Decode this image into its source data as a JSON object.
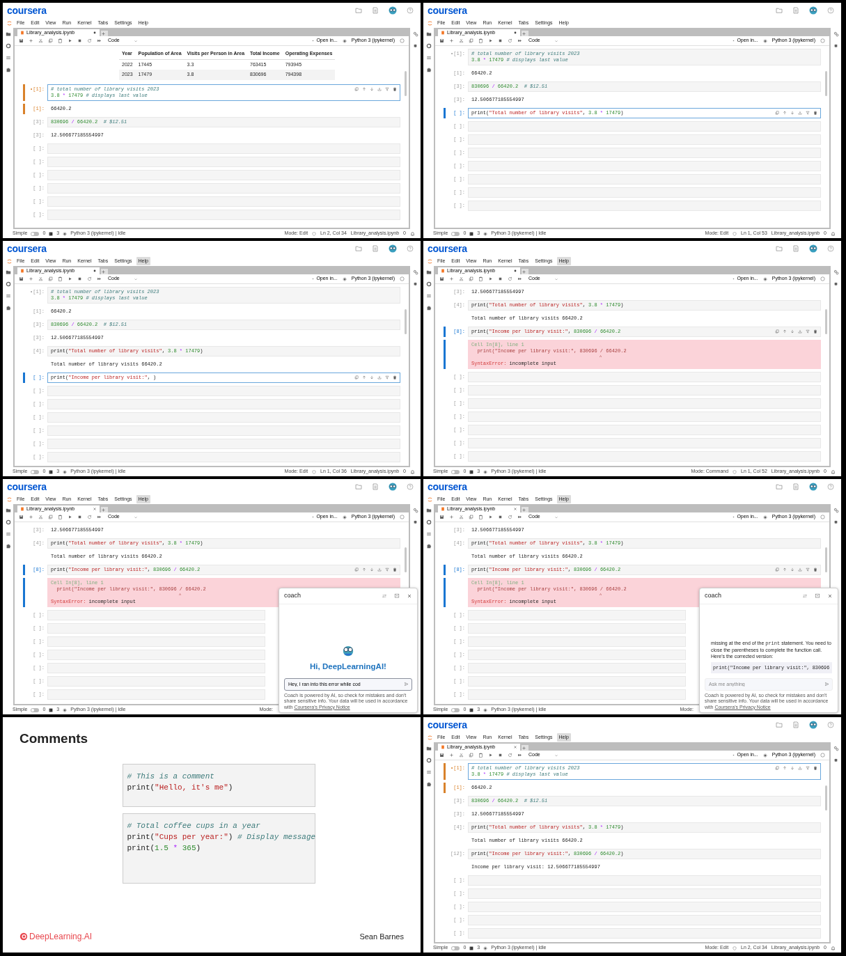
{
  "panels": [
    {
      "kind": "notebook",
      "logo": "coursera",
      "menu": [
        {
          "label": "File",
          "selected": false
        },
        {
          "label": "Edit",
          "selected": false
        },
        {
          "label": "View",
          "selected": false
        },
        {
          "label": "Run",
          "selected": false
        },
        {
          "label": "Kernel",
          "selected": false
        },
        {
          "label": "Tabs",
          "selected": false
        },
        {
          "label": "Settings",
          "selected": false
        },
        {
          "label": "Help",
          "selected": false
        }
      ],
      "tab": {
        "title": "Library_analysis.ipynb",
        "modified": true
      },
      "toolbar": {
        "cell_type": "Code",
        "open_in": "Open in...",
        "kernel": "Python 3 (ipykernel)"
      },
      "cells": [
        {
          "kind": "table",
          "columns": [
            "Year",
            "Population of Area",
            "Visits per Person in Area",
            "Total Income",
            "Operating Expenses"
          ],
          "rows": [
            [
              "2022",
              "17445",
              "3.3",
              "763415",
              "793945"
            ],
            [
              "2023",
              "17479",
              "3.8",
              "830696",
              "794398"
            ]
          ]
        },
        {
          "kind": "code",
          "prompt": "•[1]:",
          "lines": [
            "# total number of library visits 2023",
            "3.8 * 17479 # displays last value"
          ],
          "color": "#d9822b",
          "editing": true,
          "toolbar": true
        },
        {
          "kind": "output",
          "prompt": "[1]:",
          "lines": [
            "66420.2"
          ],
          "color": "#d9822b"
        },
        {
          "kind": "code",
          "prompt": "[3]:",
          "lines": [
            "830696 / 66420.2  # $12.51"
          ]
        },
        {
          "kind": "output",
          "prompt": "[3]:",
          "lines": [
            "12.506677185554997"
          ]
        },
        {
          "kind": "empty",
          "prompt": "[ ]:"
        },
        {
          "kind": "empty",
          "prompt": "[ ]:"
        },
        {
          "kind": "empty",
          "prompt": "[ ]:"
        },
        {
          "kind": "empty",
          "prompt": "[ ]:"
        },
        {
          "kind": "empty",
          "prompt": "[ ]:"
        },
        {
          "kind": "empty",
          "prompt": "[ ]:"
        }
      ],
      "status": {
        "label": "Simple",
        "simple": false,
        "terminals": "0",
        "kernels": "3",
        "kernel": "Python 3 (ipykernel) | Idle",
        "mode": "Mode: Edit",
        "position": "Ln 2, Col 34",
        "file": "Library_analysis.ipynb",
        "notifications": "0"
      }
    },
    {
      "kind": "notebook",
      "logo": "coursera",
      "menu": [
        {
          "label": "File",
          "selected": false
        },
        {
          "label": "Edit",
          "selected": false
        },
        {
          "label": "View",
          "selected": false
        },
        {
          "label": "Run",
          "selected": false
        },
        {
          "label": "Kernel",
          "selected": false
        },
        {
          "label": "Tabs",
          "selected": false
        },
        {
          "label": "Settings",
          "selected": false
        },
        {
          "label": "Help",
          "selected": false
        }
      ],
      "tab": {
        "title": "Library_analysis.ipynb",
        "modified": true
      },
      "toolbar": {
        "cell_type": "Code",
        "open_in": "Open in...",
        "kernel": "Python 3 (ipykernel)"
      },
      "cells": [
        {
          "kind": "code",
          "prompt": "•[1]:",
          "lines": [
            "# total number of library visits 2023",
            "3.8 * 17479 # displays last value"
          ]
        },
        {
          "kind": "output",
          "prompt": "[1]:",
          "lines": [
            "66420.2"
          ]
        },
        {
          "kind": "code",
          "prompt": "[3]:",
          "lines": [
            "830696 / 66420.2  # $12.51"
          ]
        },
        {
          "kind": "output",
          "prompt": "[3]:",
          "lines": [
            "12.506677185554997"
          ]
        },
        {
          "kind": "code",
          "prompt": "[ ]:",
          "lines": [
            "print(\"Total number of library visits\", 3.8 * 17479)"
          ],
          "color": "#1976d2",
          "editing": true,
          "toolbar": true
        },
        {
          "kind": "empty",
          "prompt": "[ ]:"
        },
        {
          "kind": "empty",
          "prompt": "[ ]:"
        },
        {
          "kind": "empty",
          "prompt": "[ ]:"
        },
        {
          "kind": "empty",
          "prompt": "[ ]:"
        },
        {
          "kind": "empty",
          "prompt": "[ ]:"
        },
        {
          "kind": "empty",
          "prompt": "[ ]:"
        },
        {
          "kind": "empty",
          "prompt": "[ ]:"
        }
      ],
      "status": {
        "label": "Simple",
        "simple": false,
        "terminals": "0",
        "kernels": "3",
        "kernel": "Python 3 (ipykernel) | Idle",
        "mode": "Mode: Edit",
        "position": "Ln 1, Col 53",
        "file": "Library_analysis.ipynb",
        "notifications": "0"
      }
    },
    {
      "kind": "notebook",
      "logo": "coursera",
      "menu": [
        {
          "label": "File",
          "selected": false
        },
        {
          "label": "Edit",
          "selected": false
        },
        {
          "label": "View",
          "selected": false
        },
        {
          "label": "Run",
          "selected": false
        },
        {
          "label": "Kernel",
          "selected": false
        },
        {
          "label": "Tabs",
          "selected": false
        },
        {
          "label": "Settings",
          "selected": false
        },
        {
          "label": "Help",
          "selected": true
        }
      ],
      "tab": {
        "title": "Library_analysis.ipynb",
        "modified": true
      },
      "toolbar": {
        "cell_type": "Code",
        "open_in": "Open in...",
        "kernel": "Python 3 (ipykernel)"
      },
      "cells": [
        {
          "kind": "code",
          "prompt": "•[1]:",
          "lines": [
            "# total number of library visits 2023",
            "3.8 * 17479 # displays last value"
          ]
        },
        {
          "kind": "output",
          "prompt": "[1]:",
          "lines": [
            "66420.2"
          ]
        },
        {
          "kind": "code",
          "prompt": "[3]:",
          "lines": [
            "830696 / 66420.2  # $12.51"
          ]
        },
        {
          "kind": "output",
          "prompt": "[3]:",
          "lines": [
            "12.506677185554997"
          ]
        },
        {
          "kind": "code",
          "prompt": "[4]:",
          "lines": [
            "print(\"Total number of library visits\", 3.8 * 17479)"
          ]
        },
        {
          "kind": "output",
          "lines": [
            "Total number of library visits 66420.2"
          ]
        },
        {
          "kind": "code",
          "prompt": "[ ]:",
          "lines": [
            "print(\"Income per library visit:\", )"
          ],
          "color": "#1976d2",
          "editing": true,
          "toolbar": true
        },
        {
          "kind": "empty",
          "prompt": "[ ]:"
        },
        {
          "kind": "empty",
          "prompt": "[ ]:"
        },
        {
          "kind": "empty",
          "prompt": "[ ]:"
        },
        {
          "kind": "empty",
          "prompt": "[ ]:"
        },
        {
          "kind": "empty",
          "prompt": "[ ]:"
        },
        {
          "kind": "empty",
          "prompt": "[ ]:"
        }
      ],
      "status": {
        "label": "Simple",
        "simple": false,
        "terminals": "0",
        "kernels": "3",
        "kernel": "Python 3 (ipykernel) | Idle",
        "mode": "Mode: Edit",
        "position": "Ln 1, Col 36",
        "file": "Library_analysis.ipynb",
        "notifications": "0"
      }
    },
    {
      "kind": "notebook",
      "logo": "coursera",
      "menu": [
        {
          "label": "File",
          "selected": false
        },
        {
          "label": "Edit",
          "selected": false
        },
        {
          "label": "View",
          "selected": false
        },
        {
          "label": "Run",
          "selected": false
        },
        {
          "label": "Kernel",
          "selected": false
        },
        {
          "label": "Tabs",
          "selected": false
        },
        {
          "label": "Settings",
          "selected": false
        },
        {
          "label": "Help",
          "selected": true
        }
      ],
      "tab": {
        "title": "Library_analysis.ipynb",
        "modified": true
      },
      "toolbar": {
        "cell_type": "Code",
        "open_in": "Open in...",
        "kernel": "Python 3 (ipykernel)"
      },
      "cells": [
        {
          "kind": "output",
          "prompt": "[3]:",
          "lines": [
            "12.506677185554997"
          ]
        },
        {
          "kind": "code",
          "prompt": "[4]:",
          "lines": [
            "print(\"Total number of library visits\", 3.8 * 17479)"
          ]
        },
        {
          "kind": "output",
          "lines": [
            "Total number of library visits 66420.2"
          ]
        },
        {
          "kind": "code",
          "prompt": "[8]:",
          "lines": [
            "print(\"Income per library visit:\", 830696 / 66420.2"
          ],
          "color": "#1976d2",
          "toolbar": true
        },
        {
          "kind": "error",
          "color": "#1976d2",
          "location": "Cell In[8], line 1",
          "source": "  print(\"Income per library visit:\", 830696 / 66420.2",
          "caret": "                                                   ^",
          "name": "SyntaxError:",
          "message": "incomplete input"
        },
        {
          "kind": "empty",
          "prompt": "[ ]:"
        },
        {
          "kind": "empty",
          "prompt": "[ ]:"
        },
        {
          "kind": "empty",
          "prompt": "[ ]:"
        },
        {
          "kind": "empty",
          "prompt": "[ ]:"
        },
        {
          "kind": "empty",
          "prompt": "[ ]:"
        },
        {
          "kind": "empty",
          "prompt": "[ ]:"
        },
        {
          "kind": "empty",
          "prompt": "[ ]:"
        }
      ],
      "status": {
        "label": "Simple",
        "simple": false,
        "terminals": "0",
        "kernels": "3",
        "kernel": "Python 3 (ipykernel) | Idle",
        "mode": "Mode: Command",
        "position": "Ln 1, Col 52",
        "file": "Library_analysis.ipynb",
        "notifications": "0"
      }
    },
    {
      "kind": "notebook",
      "logo": "coursera",
      "menu": [
        {
          "label": "File",
          "selected": false
        },
        {
          "label": "Edit",
          "selected": false
        },
        {
          "label": "View",
          "selected": false
        },
        {
          "label": "Run",
          "selected": false
        },
        {
          "label": "Kernel",
          "selected": false
        },
        {
          "label": "Tabs",
          "selected": false
        },
        {
          "label": "Settings",
          "selected": false
        },
        {
          "label": "Help",
          "selected": true
        }
      ],
      "tab": {
        "title": "Library_analysis.ipynb",
        "modified": false
      },
      "toolbar": {
        "cell_type": "Code",
        "open_in": "Open in...",
        "kernel": "Python 3 (ipykernel)"
      },
      "cells": [
        {
          "kind": "output",
          "prompt": "[3]:",
          "lines": [
            "12.506677185554997"
          ]
        },
        {
          "kind": "code",
          "prompt": "[4]:",
          "lines": [
            "print(\"Total number of library visits\", 3.8 * 17479)"
          ]
        },
        {
          "kind": "output",
          "lines": [
            "Total number of library visits 66420.2"
          ]
        },
        {
          "kind": "code",
          "prompt": "[8]:",
          "lines": [
            "print(\"Income per library visit:\", 830696 / 66420.2"
          ],
          "color": "#1976d2",
          "toolbar": true
        },
        {
          "kind": "error",
          "color": "#1976d2",
          "location": "Cell In[8], line 1",
          "source": "  print(\"Income per library visit:\", 830696 / 66420.2",
          "caret": "                                                   ^",
          "name": "SyntaxError:",
          "message": "incomplete input"
        },
        {
          "kind": "empty",
          "prompt": "[ ]:"
        },
        {
          "kind": "empty",
          "prompt": "[ ]:"
        },
        {
          "kind": "empty",
          "prompt": "[ ]:"
        },
        {
          "kind": "empty",
          "prompt": "[ ]:"
        },
        {
          "kind": "empty",
          "prompt": "[ ]:"
        },
        {
          "kind": "empty",
          "prompt": "[ ]:"
        },
        {
          "kind": "empty",
          "prompt": "[ ]:"
        }
      ],
      "status": {
        "label": "Simple",
        "simple": false,
        "terminals": "0",
        "kernels": "3",
        "kernel": "Python 3 (ipykernel) | Idle",
        "mode": "Mode:"
      },
      "coach": {
        "kind": "welcome",
        "title": "coach",
        "greeting": "Hi, DeepLearningAI!",
        "input": {
          "value": "Hey, I ran into this error while cod"
        },
        "disclaimer": "Coach is powered by AI, so check for mistakes and don't share sensitive info. Your data will be used in accordance with",
        "link": "Coursera's Privacy Notice"
      }
    },
    {
      "kind": "notebook",
      "logo": "coursera",
      "menu": [
        {
          "label": "File",
          "selected": false
        },
        {
          "label": "Edit",
          "selected": false
        },
        {
          "label": "View",
          "selected": false
        },
        {
          "label": "Run",
          "selected": false
        },
        {
          "label": "Kernel",
          "selected": false
        },
        {
          "label": "Tabs",
          "selected": false
        },
        {
          "label": "Settings",
          "selected": false
        },
        {
          "label": "Help",
          "selected": true
        }
      ],
      "tab": {
        "title": "Library_analysis.ipynb",
        "modified": false
      },
      "toolbar": {
        "cell_type": "Code",
        "open_in": "Open in...",
        "kernel": "Python 3 (ipykernel)"
      },
      "cells": [
        {
          "kind": "output",
          "prompt": "[3]:",
          "lines": [
            "12.506677185554997"
          ]
        },
        {
          "kind": "code",
          "prompt": "[4]:",
          "lines": [
            "print(\"Total number of library visits\", 3.8 * 17479)"
          ]
        },
        {
          "kind": "output",
          "lines": [
            "Total number of library visits 66420.2"
          ]
        },
        {
          "kind": "code",
          "prompt": "[8]:",
          "lines": [
            "print(\"Income per library visit:\", 830696 / 66420.2"
          ],
          "color": "#1976d2",
          "toolbar": true
        },
        {
          "kind": "error",
          "color": "#1976d2",
          "location": "Cell In[8], line 1",
          "source": "  print(\"Income per library visit:\", 830696 / 66420.2",
          "caret": "                                                   ^",
          "name": "SyntaxError:",
          "message": "incomplete input"
        },
        {
          "kind": "empty",
          "prompt": "[ ]:"
        },
        {
          "kind": "empty",
          "prompt": "[ ]:"
        },
        {
          "kind": "empty",
          "prompt": "[ ]:"
        },
        {
          "kind": "empty",
          "prompt": "[ ]:"
        },
        {
          "kind": "empty",
          "prompt": "[ ]:"
        },
        {
          "kind": "empty",
          "prompt": "[ ]:"
        },
        {
          "kind": "empty",
          "prompt": "[ ]:"
        }
      ],
      "status": {
        "label": "Simple",
        "simple": false,
        "terminals": "0",
        "kernels": "3",
        "kernel": "Python 3 (ipykernel) | Idle",
        "mode": "Mode:"
      },
      "coach": {
        "kind": "chat",
        "title": "coach",
        "message": [
          {
            "kind": "text",
            "text": "missing at the end of the "
          },
          {
            "kind": "code",
            "text": "print"
          },
          {
            "kind": "text",
            "text": " statement. You need to close the parentheses to complete the function call. Here's the corrected version:"
          }
        ],
        "code": "print(\"Income per library visit:\", 830696",
        "input": {
          "placeholder": "Ask me anything"
        },
        "disclaimer": "Coach is powered by AI, so check for mistakes and don't share sensitive info. Your data will be used in accordance with",
        "link": "Coursera's Privacy Notice"
      }
    },
    {
      "kind": "slide",
      "title": "Comments",
      "code_blocks": [
        [
          "# This is a comment",
          "print(\"Hello, it's me\")"
        ],
        [
          "# Total coffee cups in a year",
          "print(\"Cups per year:\") # Display message",
          "print(1.5 * 365)"
        ]
      ],
      "brand": "DeepLearning.AI",
      "presenter": "Sean Barnes"
    },
    {
      "kind": "notebook",
      "logo": "coursera",
      "menu": [
        {
          "label": "File",
          "selected": false
        },
        {
          "label": "Edit",
          "selected": false
        },
        {
          "label": "View",
          "selected": false
        },
        {
          "label": "Run",
          "selected": false
        },
        {
          "label": "Kernel",
          "selected": false
        },
        {
          "label": "Tabs",
          "selected": false
        },
        {
          "label": "Settings",
          "selected": false
        },
        {
          "label": "Help",
          "selected": true
        }
      ],
      "tab": {
        "title": "Library_analysis.ipynb",
        "modified": false
      },
      "toolbar": {
        "cell_type": "Code",
        "open_in": "Open in...",
        "kernel": "Python 3 (ipykernel)"
      },
      "cells": [
        {
          "kind": "code",
          "prompt": "•[1]:",
          "lines": [
            "# total number of library visits 2023",
            "3.8 * 17479 # displays last value"
          ],
          "color": "#d9822b",
          "editing": true,
          "toolbar": true
        },
        {
          "kind": "output",
          "prompt": "[1]:",
          "lines": [
            "66420.2"
          ],
          "color": "#d9822b"
        },
        {
          "kind": "code",
          "prompt": "[3]:",
          "lines": [
            "830696 / 66420.2  # $12.51"
          ]
        },
        {
          "kind": "output",
          "prompt": "[3]:",
          "lines": [
            "12.506677185554997"
          ]
        },
        {
          "kind": "code",
          "prompt": "[4]:",
          "lines": [
            "print(\"Total number of library visits\", 3.8 * 17479)"
          ]
        },
        {
          "kind": "output",
          "lines": [
            "Total number of library visits 66420.2"
          ]
        },
        {
          "kind": "code",
          "prompt": "[12]:",
          "lines": [
            "print(\"Income per library visit:\", 830696 / 66420.2)"
          ]
        },
        {
          "kind": "output",
          "lines": [
            "Income per library visit: 12.506677185554997"
          ]
        },
        {
          "kind": "empty",
          "prompt": "[ ]:"
        },
        {
          "kind": "empty",
          "prompt": "[ ]:"
        },
        {
          "kind": "empty",
          "prompt": "[ ]:"
        },
        {
          "kind": "empty",
          "prompt": "[ ]:"
        },
        {
          "kind": "empty",
          "prompt": "[ ]:"
        }
      ],
      "status": {
        "label": "Simple",
        "simple": false,
        "terminals": "0",
        "kernels": "3",
        "kernel": "Python 3 (ipykernel) | Idle",
        "mode": "Mode: Edit",
        "position": "Ln 2, Col 34",
        "file": "Library_analysis.ipynb",
        "notifications": "0"
      }
    }
  ]
}
